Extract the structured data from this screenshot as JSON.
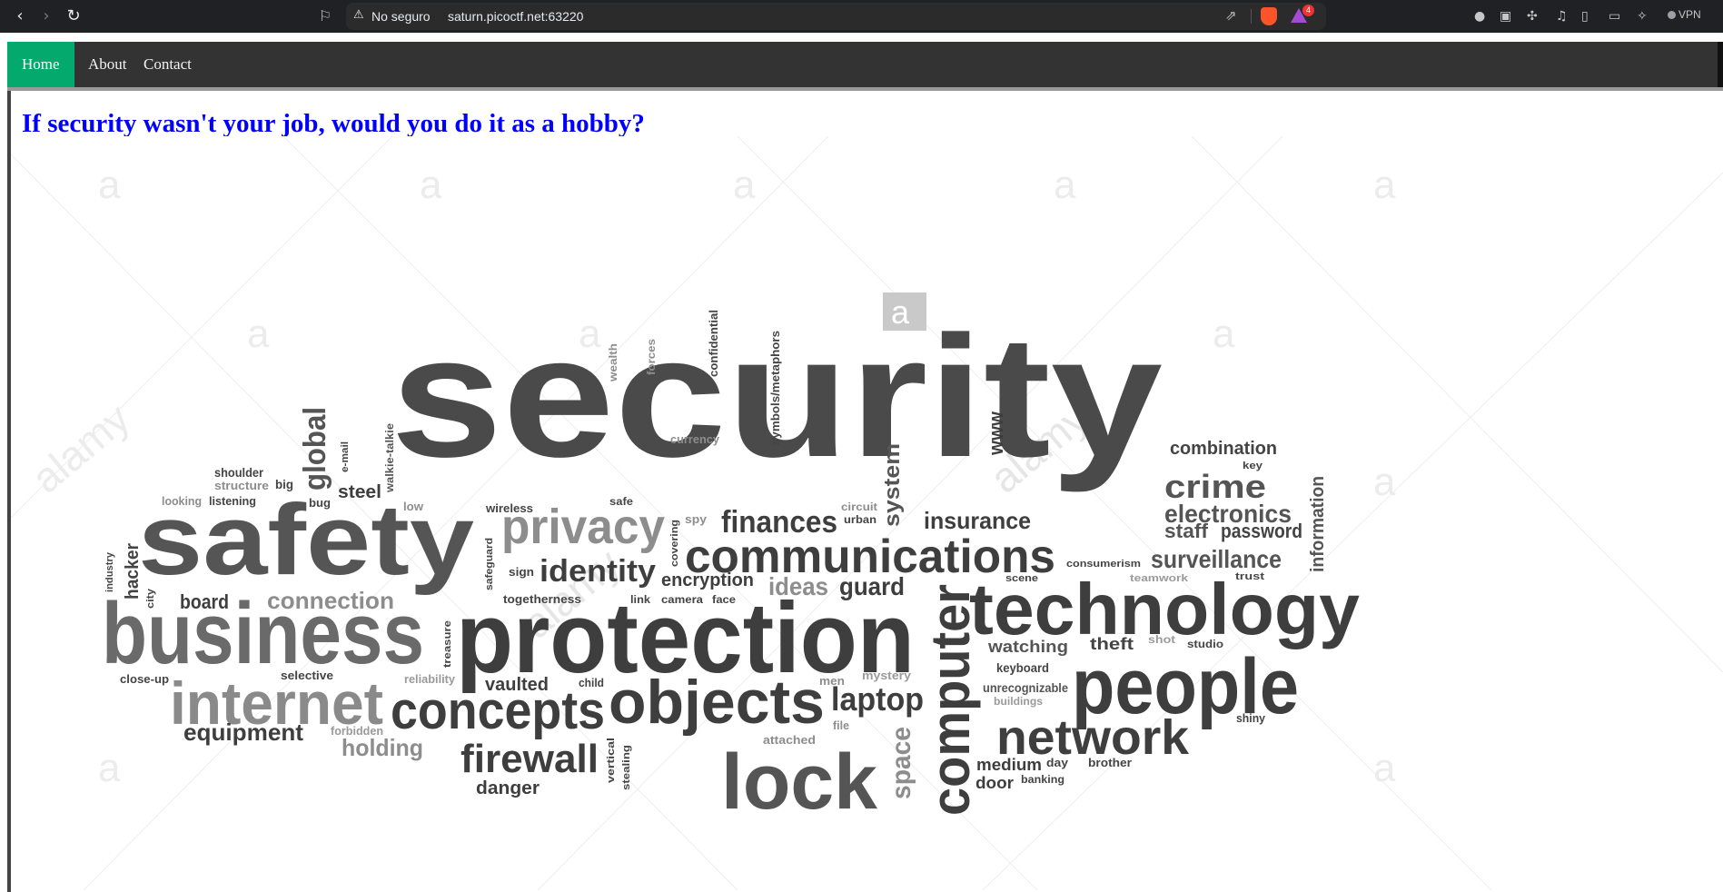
{
  "browser": {
    "back_icon": "chevron-left-icon",
    "forward_icon": "chevron-right-icon",
    "reload_icon": "reload-icon",
    "bookmark_icon": "bookmark-icon",
    "security_label": "No seguro",
    "url": "saturn.picoctf.net:63220",
    "rewards_badge": "4",
    "vpn_label": "VPN"
  },
  "nav": {
    "items": [
      {
        "label": "Home"
      },
      {
        "label": "About"
      },
      {
        "label": "Contact"
      }
    ]
  },
  "page": {
    "heading": "If security wasn't your job, would you do it as a hobby?"
  },
  "image": {
    "watermark": "a",
    "watermark_brand": "alamy",
    "words": [
      {
        "text": "security"
      },
      {
        "text": "safety"
      },
      {
        "text": "business"
      },
      {
        "text": "protection"
      },
      {
        "text": "technology"
      },
      {
        "text": "people"
      },
      {
        "text": "communications"
      },
      {
        "text": "objects"
      },
      {
        "text": "concepts"
      },
      {
        "text": "internet"
      },
      {
        "text": "network"
      },
      {
        "text": "privacy"
      },
      {
        "text": "identity"
      },
      {
        "text": "firewall"
      },
      {
        "text": "lock"
      },
      {
        "text": "computer"
      },
      {
        "text": "crime"
      },
      {
        "text": "electronics"
      },
      {
        "text": "surveillance"
      },
      {
        "text": "combination"
      },
      {
        "text": "finances"
      },
      {
        "text": "insurance"
      },
      {
        "text": "laptop"
      },
      {
        "text": "global"
      },
      {
        "text": "guard"
      },
      {
        "text": "ideas"
      },
      {
        "text": "encryption"
      },
      {
        "text": "connection"
      },
      {
        "text": "board"
      },
      {
        "text": "equipment"
      },
      {
        "text": "holding"
      },
      {
        "text": "vaulted"
      },
      {
        "text": "password"
      },
      {
        "text": "staff"
      },
      {
        "text": "information"
      },
      {
        "text": "system"
      },
      {
        "text": "steel"
      },
      {
        "text": "hacker"
      },
      {
        "text": "watching"
      },
      {
        "text": "theft"
      },
      {
        "text": "keyboard"
      },
      {
        "text": "unrecognizable"
      },
      {
        "text": "medium"
      },
      {
        "text": "wireless"
      },
      {
        "text": "sign"
      },
      {
        "text": "togetherness"
      },
      {
        "text": "spy"
      },
      {
        "text": "currency"
      },
      {
        "text": "confidential"
      },
      {
        "text": "symbols/metaphors"
      },
      {
        "text": "wealth"
      },
      {
        "text": "forces"
      },
      {
        "text": "www"
      },
      {
        "text": "shoulder"
      },
      {
        "text": "structure"
      },
      {
        "text": "looking"
      },
      {
        "text": "listening"
      },
      {
        "text": "big"
      },
      {
        "text": "bug"
      },
      {
        "text": "e-mail"
      },
      {
        "text": "walkie-talkie"
      },
      {
        "text": "low"
      },
      {
        "text": "safe"
      },
      {
        "text": "circuit"
      },
      {
        "text": "urban"
      },
      {
        "text": "consumerism"
      },
      {
        "text": "teamwork"
      },
      {
        "text": "trust"
      },
      {
        "text": "key"
      },
      {
        "text": "industry"
      },
      {
        "text": "city"
      },
      {
        "text": "close-up"
      },
      {
        "text": "selective"
      },
      {
        "text": "reliability"
      },
      {
        "text": "child"
      },
      {
        "text": "men"
      },
      {
        "text": "mystery"
      },
      {
        "text": "forbidden"
      },
      {
        "text": "attached"
      },
      {
        "text": "file"
      },
      {
        "text": "day"
      },
      {
        "text": "brother"
      },
      {
        "text": "banking"
      },
      {
        "text": "studio"
      },
      {
        "text": "shiny"
      },
      {
        "text": "buildings"
      },
      {
        "text": "scene"
      },
      {
        "text": "camera"
      },
      {
        "text": "face"
      },
      {
        "text": "link"
      },
      {
        "text": "safeguard"
      },
      {
        "text": "treasure"
      },
      {
        "text": "covering"
      },
      {
        "text": "vertical"
      },
      {
        "text": "stealing"
      },
      {
        "text": "danger"
      },
      {
        "text": "door"
      },
      {
        "text": "shot"
      },
      {
        "text": "space"
      }
    ]
  }
}
